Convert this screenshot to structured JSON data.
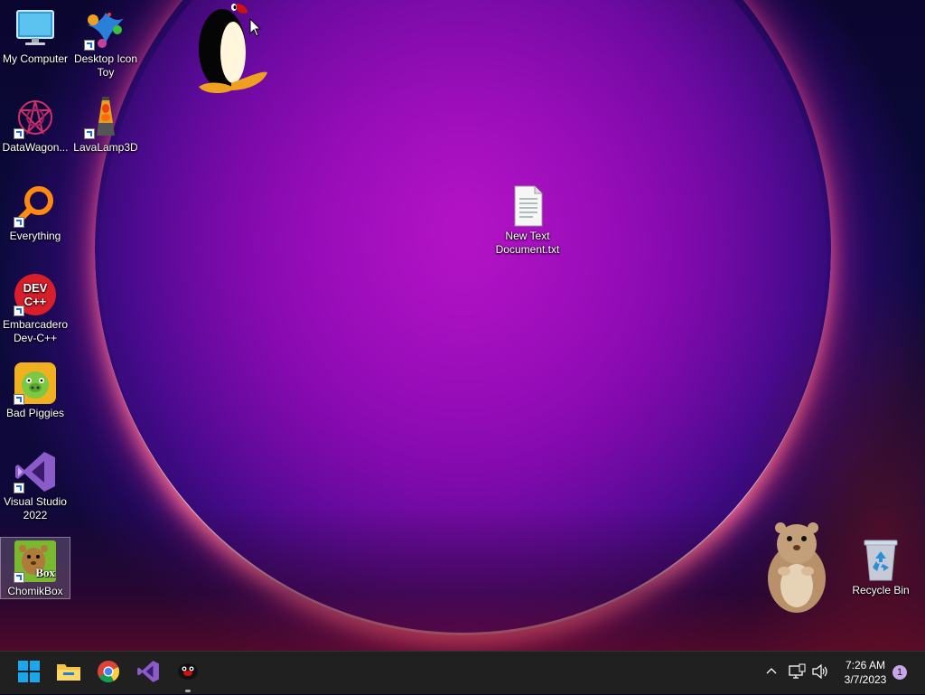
{
  "desktop": {
    "icons": [
      {
        "label": "My Computer",
        "icon": "monitor-icon"
      },
      {
        "label": "Desktop Icon Toy",
        "icon": "desktop-icon-toy-icon"
      },
      {
        "label": "DataWagon...",
        "icon": "datawagon-icon"
      },
      {
        "label": "LavaLamp3D",
        "icon": "lava-lamp-icon"
      },
      {
        "label": "Everything",
        "icon": "magnifier-icon"
      },
      {
        "label": "New Text Document.txt",
        "icon": "text-document-icon"
      },
      {
        "label": "Embarcadero Dev-C++",
        "icon": "devcpp-icon",
        "badge": "DEV C++"
      },
      {
        "label": "Bad Piggies",
        "icon": "bad-piggies-icon"
      },
      {
        "label": "Visual Studio 2022",
        "icon": "visual-studio-icon"
      },
      {
        "label": "ChomikBox",
        "icon": "chomikbox-icon",
        "badge": "Box",
        "selected": true
      },
      {
        "label": "Recycle Bin",
        "icon": "recycle-bin-icon"
      }
    ],
    "pets": [
      {
        "name": "penguin-desktop-pet"
      },
      {
        "name": "hamster-desktop-pet"
      }
    ]
  },
  "taskbar": {
    "apps": [
      {
        "name": "start-button",
        "icon": "windows-logo-icon"
      },
      {
        "name": "file-explorer",
        "icon": "folder-icon"
      },
      {
        "name": "chrome",
        "icon": "chrome-icon"
      },
      {
        "name": "visual-studio",
        "icon": "visual-studio-icon"
      },
      {
        "name": "penguin-app",
        "icon": "penguin-icon",
        "running": true
      }
    ],
    "tray": {
      "icons": [
        "chevron-up-icon",
        "network-icon",
        "volume-icon"
      ],
      "time": "7:26 AM",
      "date": "3/7/2023",
      "notifications": "1"
    }
  },
  "colors": {
    "taskbar_bg": "#202020",
    "wallpaper_core": "#9a10c0",
    "wallpaper_rim": "#ff4a8a"
  }
}
